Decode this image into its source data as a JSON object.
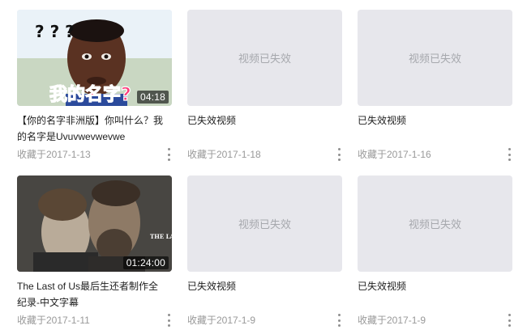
{
  "favorites": [
    {
      "title": "【你的名字非洲版】你叫什么？我的名字是Uvuvwevwevwe",
      "duration": "04:18",
      "date": "收藏于2017-1-13",
      "thumb_overlay_text": "我的名字?",
      "thumb_marks": "? ? ?"
    },
    {
      "title": "已失效视频",
      "placeholder": "视频已失效",
      "date": "收藏于2017-1-18"
    },
    {
      "title": "已失效视频",
      "placeholder": "视频已失效",
      "date": "收藏于2017-1-16"
    },
    {
      "title": "The Last of Us最后生还者制作全纪录-中文字幕",
      "duration": "01:24:00",
      "date": "收藏于2017-1-11",
      "thumb_logo_text": "THE LAST OF US"
    },
    {
      "title": "已失效视频",
      "placeholder": "视频已失效",
      "date": "收藏于2017-1-9"
    },
    {
      "title": "已失效视频",
      "placeholder": "视频已失效",
      "date": "收藏于2017-1-9"
    }
  ],
  "icons": {
    "more": "more-vertical-icon"
  },
  "colors": {
    "placeholder_bg": "#e7e7ec",
    "placeholder_text": "#a6a8ad",
    "meta_text": "#999999",
    "overlay_text": "#ff3b7a"
  }
}
